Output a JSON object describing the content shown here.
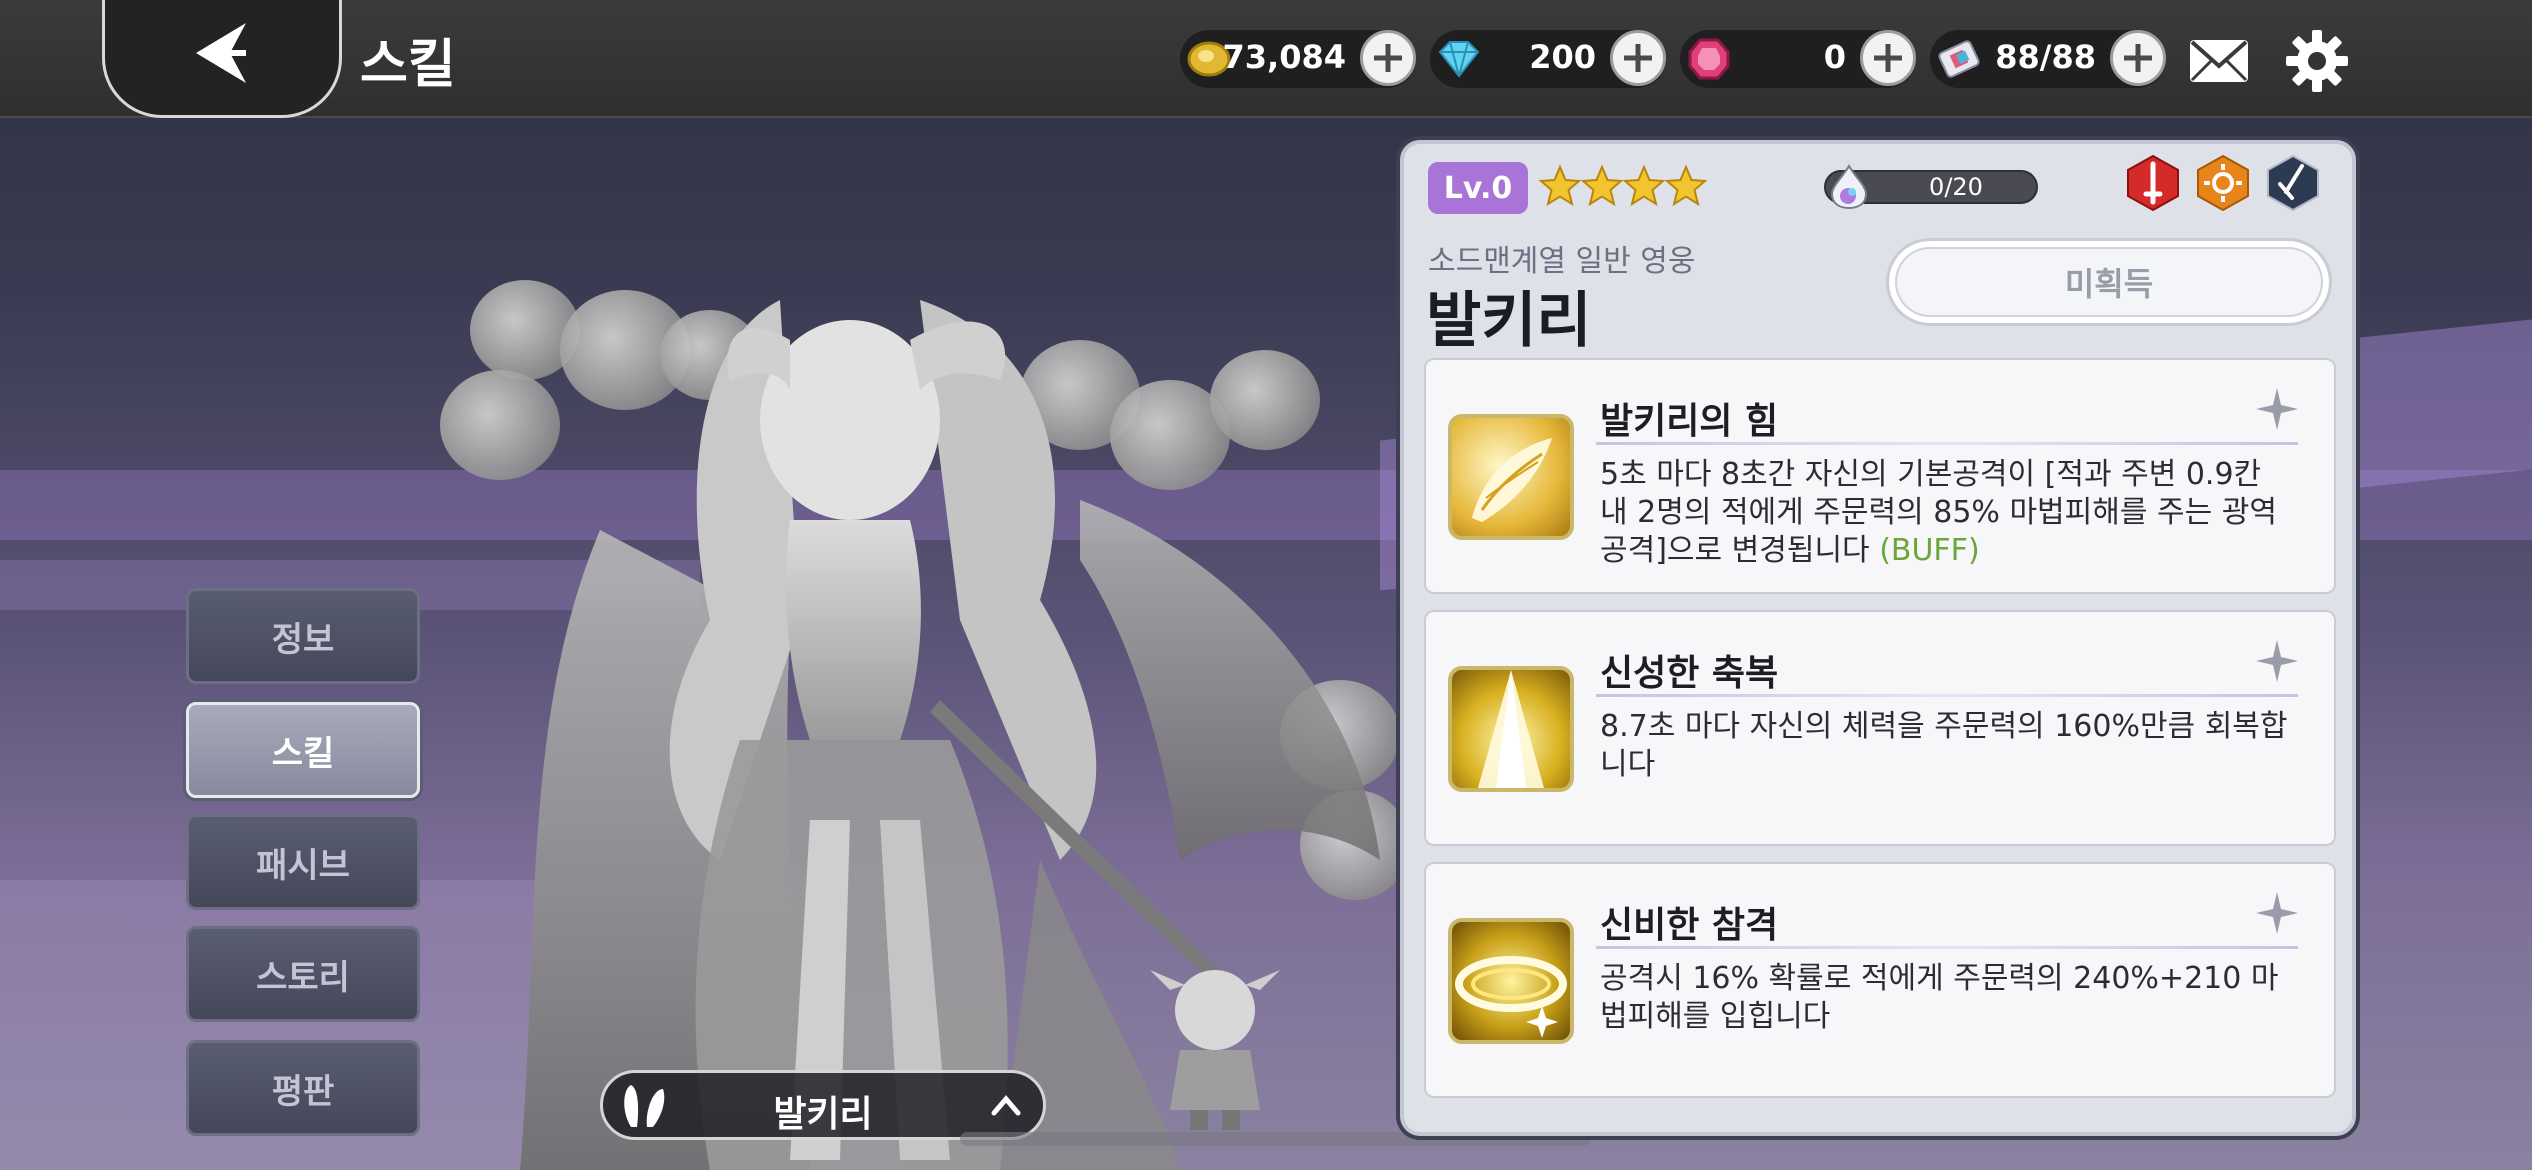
{
  "header": {
    "title": "스킬",
    "back_label": "back"
  },
  "currencies": [
    {
      "icon": "gold-coin-icon",
      "value": "73,084"
    },
    {
      "icon": "diamond-icon",
      "value": "200"
    },
    {
      "icon": "ruby-gem-icon",
      "value": "0"
    },
    {
      "icon": "ticket-icon",
      "value": "88/88"
    }
  ],
  "menu": {
    "items": [
      {
        "label": "정보",
        "active": false
      },
      {
        "label": "스킬",
        "active": true
      },
      {
        "label": "패시브",
        "active": false
      },
      {
        "label": "스토리",
        "active": false
      },
      {
        "label": "평판",
        "active": false
      }
    ]
  },
  "hero_selector": {
    "name": "발키리"
  },
  "panel": {
    "level": "Lv.0",
    "stars": 4,
    "exp_text": "0/20",
    "subtitle": "소드맨계열 일반 영웅",
    "hero_name": "발키리",
    "status_label": "미획득",
    "class_icons": [
      "sword-class-icon",
      "sun-element-icon",
      "dagger-type-icon"
    ]
  },
  "skills": [
    {
      "title": "발키리의 힘",
      "desc": "5초 마다 8초간 자신의 기본공격이 [적과 주변 0.9칸 내 2명의 적에게 주문력의 85% 마법피해를 주는 광역 공격]으로 변경됩니다 ",
      "tag": "(BUFF)",
      "icon": "wing-skill-icon"
    },
    {
      "title": "신성한 축복",
      "desc": "8.7초 마다 자신의 체력을 주문력의 160%만큼 회복합니다",
      "tag": "",
      "icon": "light-beam-skill-icon"
    },
    {
      "title": "신비한 참격",
      "desc": "공격시 16% 확률로 적에게 주문력의 240%+210 마법피해를 입힙니다",
      "tag": "",
      "icon": "slash-skill-icon"
    }
  ],
  "colors": {
    "level_badge": "#a874d8",
    "buff_text": "#6aa63a",
    "panel_bg": "#dfe1e8"
  }
}
